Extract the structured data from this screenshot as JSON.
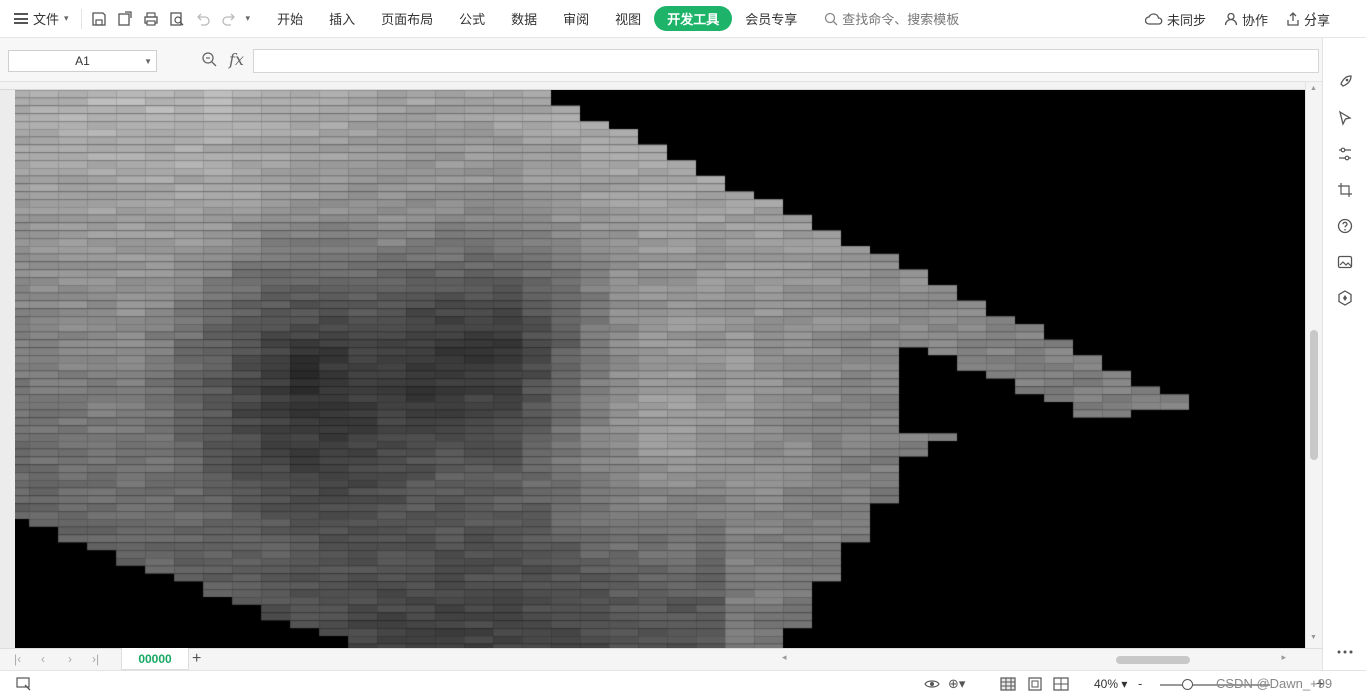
{
  "menu": {
    "file_label": "文件",
    "tabs": [
      "开始",
      "插入",
      "页面布局",
      "公式",
      "数据",
      "审阅",
      "视图",
      "开发工具",
      "会员专享"
    ],
    "active_tab": "开发工具",
    "search_placeholder": "查找命令、搜索模板",
    "sync_label": "未同步",
    "collab_label": "协作",
    "share_label": "分享"
  },
  "formula_bar": {
    "cell_ref": "A1",
    "fx_label": "fx",
    "formula_value": ""
  },
  "sheet": {
    "active_tab": "00000",
    "add_label": "+"
  },
  "status": {
    "zoom": "40%",
    "zoom_minus": "-",
    "zoom_plus": "+",
    "watermark": "CSDN @Dawn_+99"
  },
  "colors": {
    "accent": "#1db469",
    "sheet_background": "#000000"
  }
}
